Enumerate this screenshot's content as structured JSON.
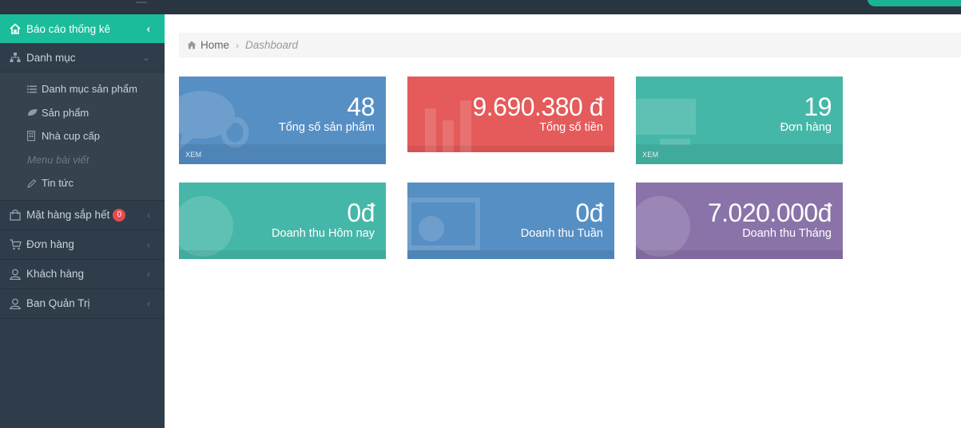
{
  "sidebar": {
    "items": [
      {
        "label": "Báo cáo thống kê",
        "icon": "home-icon"
      },
      {
        "label": "Danh mục",
        "icon": "sitemap-icon"
      },
      {
        "label": "Mặt hàng sắp hết",
        "icon": "shopping-bag-icon",
        "badge": "0"
      },
      {
        "label": "Đơn hàng",
        "icon": "cart-icon"
      },
      {
        "label": "Khách hàng",
        "icon": "user-icon"
      },
      {
        "label": "Ban Quản Trị",
        "icon": "user-icon"
      }
    ],
    "submenu": [
      {
        "label": "Danh mục sản phẩm",
        "icon": "list-icon"
      },
      {
        "label": "Sản phẩm",
        "icon": "leaf-icon"
      },
      {
        "label": "Nhà cup cấp",
        "icon": "building-icon"
      },
      {
        "label": "Menu bài viết",
        "icon": ""
      },
      {
        "label": "Tin tức",
        "icon": "pencil-icon"
      }
    ]
  },
  "breadcrumb": {
    "home": "Home",
    "current": "Dashboard"
  },
  "cards": [
    {
      "value": "48",
      "label": "Tổng số sản phẩm",
      "footer": "XEM",
      "color": "#568fc4",
      "icon": "comments-icon"
    },
    {
      "value": "9.690.380 đ",
      "label": "Tổng số tiền",
      "color": "#e55a5a",
      "icon": "bar-chart-icon"
    },
    {
      "value": "19",
      "label": "Đơn hàng",
      "footer": "XEM",
      "color": "#45b7a8",
      "icon": "truck-icon"
    },
    {
      "value": "0đ",
      "label": "Doanh thu Hôm nay",
      "color": "#45b7a8",
      "icon": "globe-icon"
    },
    {
      "value": "0đ",
      "label": "Doanh thu Tuần",
      "color": "#568fc4",
      "icon": "money-icon"
    },
    {
      "value": "7.020.000đ",
      "label": "Doanh thu Tháng",
      "color": "#8a73a9",
      "icon": "globe-icon"
    }
  ],
  "colors": {
    "accent": "#1abc9c",
    "sidebar_bg": "#2f3d4a",
    "topbar_bg": "#2a3542",
    "badge": "#e74c4c"
  }
}
